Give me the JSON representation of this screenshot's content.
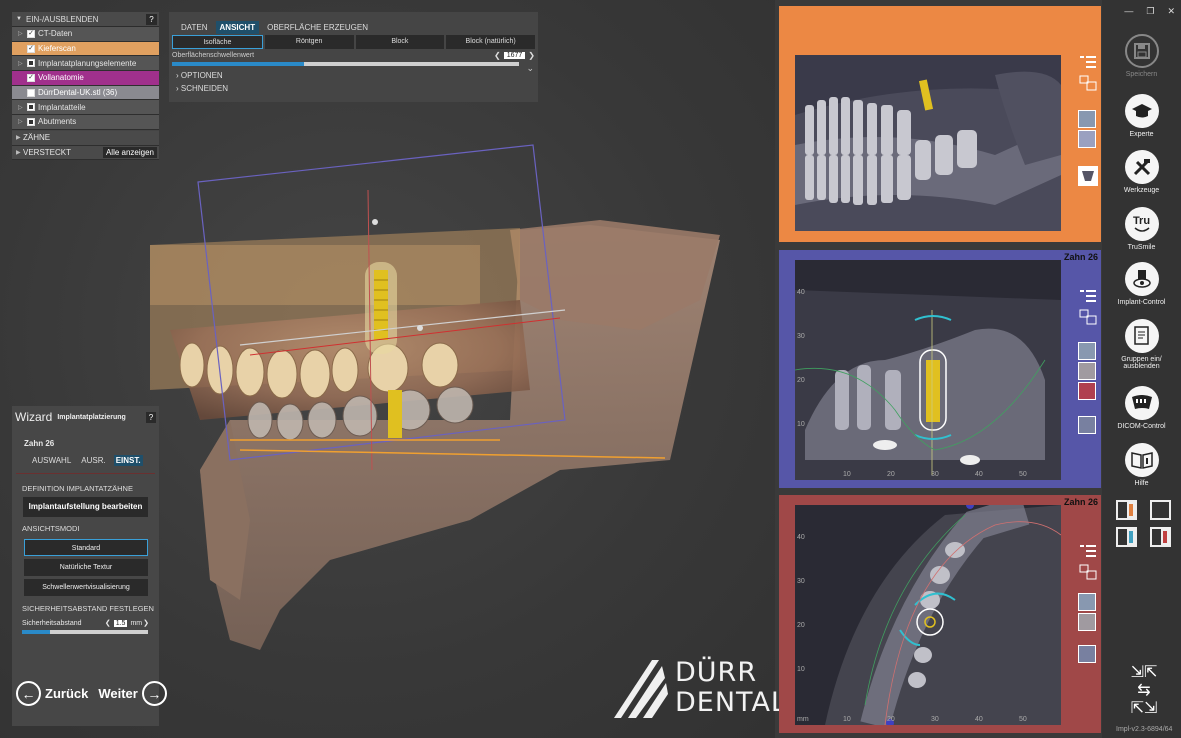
{
  "tree": {
    "header": "EIN-/AUSBLENDEN",
    "help": "?",
    "items": [
      {
        "label": "CT-Daten",
        "checked": true
      },
      {
        "label": "Kieferscan",
        "checked": true
      },
      {
        "label": "Implantatplanungselemente",
        "checked": false
      },
      {
        "label": "Vollanatomie",
        "checked": true
      },
      {
        "label": "DürrDental-UK.stl (36)",
        "checked": false
      },
      {
        "label": "Implantatteile",
        "checked": false
      },
      {
        "label": "Abutments",
        "checked": false
      }
    ],
    "section_zaehne": "ZÄHNE",
    "section_versteckt": "VERSTECKT",
    "show_all": "Alle anzeigen"
  },
  "view_panel": {
    "tabs": [
      "DATEN",
      "ANSICHT",
      "OBERFLÄCHE ERZEUGEN"
    ],
    "active_tab": "ANSICHT",
    "modes": [
      "Isofläche",
      "Röntgen",
      "Block",
      "Block (natürlich)"
    ],
    "active_mode": "Isofläche",
    "threshold_label": "Oberflächenschwellenwert",
    "threshold_value": "1677",
    "threshold_fraction": 0.38,
    "options": "OPTIONEN",
    "cut": "SCHNEIDEN"
  },
  "wizard": {
    "title": "Wizard",
    "subtitle": "Implantatplatzierung",
    "help": "?",
    "tooth": "Zahn 26",
    "tabs": [
      "AUSWAHL",
      "AUSR.",
      "EINST."
    ],
    "active_tab": "EINST.",
    "def_heading": "DEFINITION IMPLANTATZÄHNE",
    "def_button": "Implantaufstellung bearbeiten",
    "modes_heading": "ANSICHTSMODI",
    "modes": [
      "Standard",
      "Natürliche Textur",
      "Schwellenwertvisualisierung"
    ],
    "active_mode": "Standard",
    "safety_heading": "SICHERHEITSABSTAND FESTLEGEN",
    "safety_label": "Sicherheitsabstand",
    "safety_value": "1.5",
    "safety_unit": "mm",
    "safety_fraction": 0.22,
    "back": "Zurück",
    "next": "Weiter"
  },
  "logo": {
    "line1": "DÜRR",
    "line2": "DENTAL"
  },
  "panels": {
    "p2_title": "Zahn 26",
    "p3_title": "Zahn 26",
    "p2_yticks": [
      "40",
      "30",
      "20",
      "10"
    ],
    "p2_xticks": [
      "10",
      "20",
      "30",
      "40",
      "50"
    ],
    "p3_yticks": [
      "40",
      "30",
      "20",
      "10"
    ],
    "p3_xticks": [
      "mm",
      "10",
      "20",
      "30",
      "40",
      "50"
    ]
  },
  "sidebar": {
    "items": [
      {
        "label": "Speichern",
        "icon": "save-icon"
      },
      {
        "label": "Experte",
        "icon": "graduation-cap-icon"
      },
      {
        "label": "Werkzeuge",
        "icon": "tools-icon"
      },
      {
        "label": "TruSmile",
        "icon": "trusmile-icon"
      },
      {
        "label": "Implant-Control",
        "icon": "implant-control-icon"
      },
      {
        "label": "Gruppen ein/ ausblenden",
        "icon": "groups-icon"
      },
      {
        "label": "DICOM-Control",
        "icon": "dicom-icon"
      },
      {
        "label": "Hilfe",
        "icon": "help-book-icon"
      }
    ],
    "tru_text": "Tru",
    "version": "Impl-v2.3-6894/64"
  },
  "colors": {
    "panel1": "#ec8844",
    "panel2": "#5656a8",
    "panel3": "#a04848",
    "accent": "#2a8ac8"
  }
}
